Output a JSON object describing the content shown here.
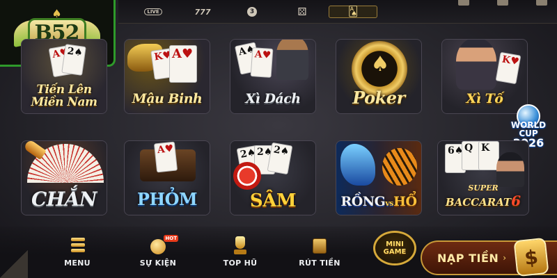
{
  "filters": [
    {
      "label": "LIVE",
      "icon": "live-icon",
      "active": false
    },
    {
      "label": "777",
      "icon": "slot-icon",
      "active": false
    },
    {
      "label": "3",
      "icon": "ball-icon",
      "active": false
    },
    {
      "label": "⚄",
      "icon": "dice-icon",
      "active": false
    },
    {
      "label": "🂡",
      "icon": "cards-icon",
      "active": true
    }
  ],
  "logo": {
    "text": "B52"
  },
  "games": [
    {
      "title": "Tiến Lên\nMiền Nam",
      "line1": "Tiến Lên",
      "line2": "Miền Nam"
    },
    {
      "title": "Mậu Binh"
    },
    {
      "title": "Xì Dách"
    },
    {
      "title": "Poker"
    },
    {
      "title": "Xì Tố"
    },
    {
      "title": "CHẮN"
    },
    {
      "title": "PHỎM"
    },
    {
      "title": "SÂM"
    },
    {
      "title": "RỒNG vs HỔ",
      "line1": "RỒNG",
      "vs": "vs",
      "line2": "HỔ"
    },
    {
      "title": "SUPER BACCARAT 6",
      "line1": "SUPER",
      "line2": "BACCARAT",
      "num": "6"
    }
  ],
  "badge": {
    "line1": "WORLD CUP",
    "line2": "2026"
  },
  "bottom_nav": [
    {
      "label": "MENU",
      "icon": "menu-icon"
    },
    {
      "label": "SỰ KIỆN",
      "icon": "event-icon",
      "hot": "HOT"
    },
    {
      "label": "TOP HŨ",
      "icon": "trophy-icon"
    },
    {
      "label": "RÚT TIỀN",
      "icon": "withdraw-icon"
    }
  ],
  "minigame": {
    "line1": "MINI",
    "line2": "GAME"
  },
  "deposit": {
    "label": "NẠP TIỀN",
    "symbol": "$"
  }
}
